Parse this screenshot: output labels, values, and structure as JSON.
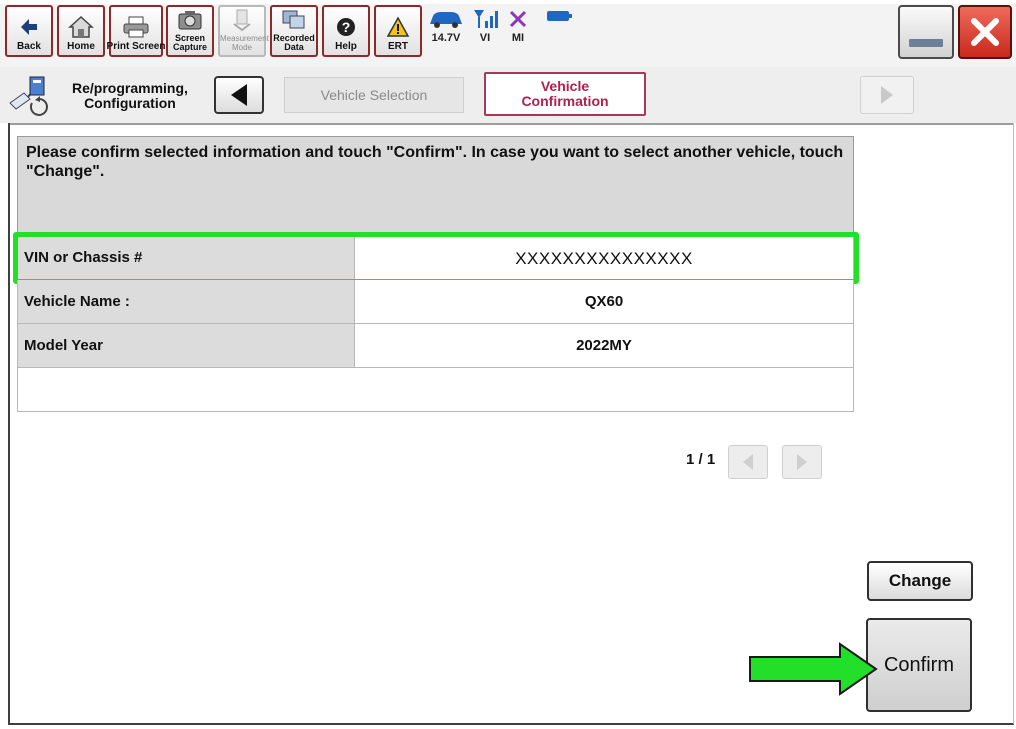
{
  "toolbar": {
    "buttons": [
      {
        "label": "Back",
        "icon": "back-arrow-icon"
      },
      {
        "label": "Home",
        "icon": "home-icon"
      },
      {
        "label": "Print Screen",
        "icon": "printer-icon"
      },
      {
        "label": "Screen Capture",
        "icon": "camera-icon"
      },
      {
        "label": "Measurement Mode",
        "icon": "measurement-icon"
      },
      {
        "label": "Recorded Data",
        "icon": "recorded-data-icon"
      },
      {
        "label": "Help",
        "icon": "help-icon"
      },
      {
        "label": "ERT",
        "icon": "warning-icon"
      }
    ],
    "status": [
      {
        "label": "14.7V",
        "icon": "car-battery-icon"
      },
      {
        "label": "VI",
        "icon": "signal-icon"
      },
      {
        "label": "MI",
        "icon": "mi-disconnected-icon"
      }
    ]
  },
  "breadcrumb": {
    "home_line1": "Re/programming,",
    "home_line2": "Configuration",
    "step1": "Vehicle Selection",
    "step2_line1": "Vehicle",
    "step2_line2": "Confirmation"
  },
  "main": {
    "instruction": "Please confirm selected information and touch \"Confirm\". In case you want to select another vehicle, touch \"Change\".",
    "rows": [
      {
        "label": "VIN or Chassis #",
        "value": "XXXXXXXXXXXXXXX"
      },
      {
        "label": "Vehicle Name :",
        "value": "QX60"
      },
      {
        "label": "Model Year",
        "value": "2022MY"
      }
    ],
    "page": "1 / 1",
    "change_label": "Change",
    "confirm_label": "Confirm"
  },
  "colors": {
    "highlight": "#22e02a",
    "active_tab": "#b0204c",
    "close": "#c8291c"
  }
}
